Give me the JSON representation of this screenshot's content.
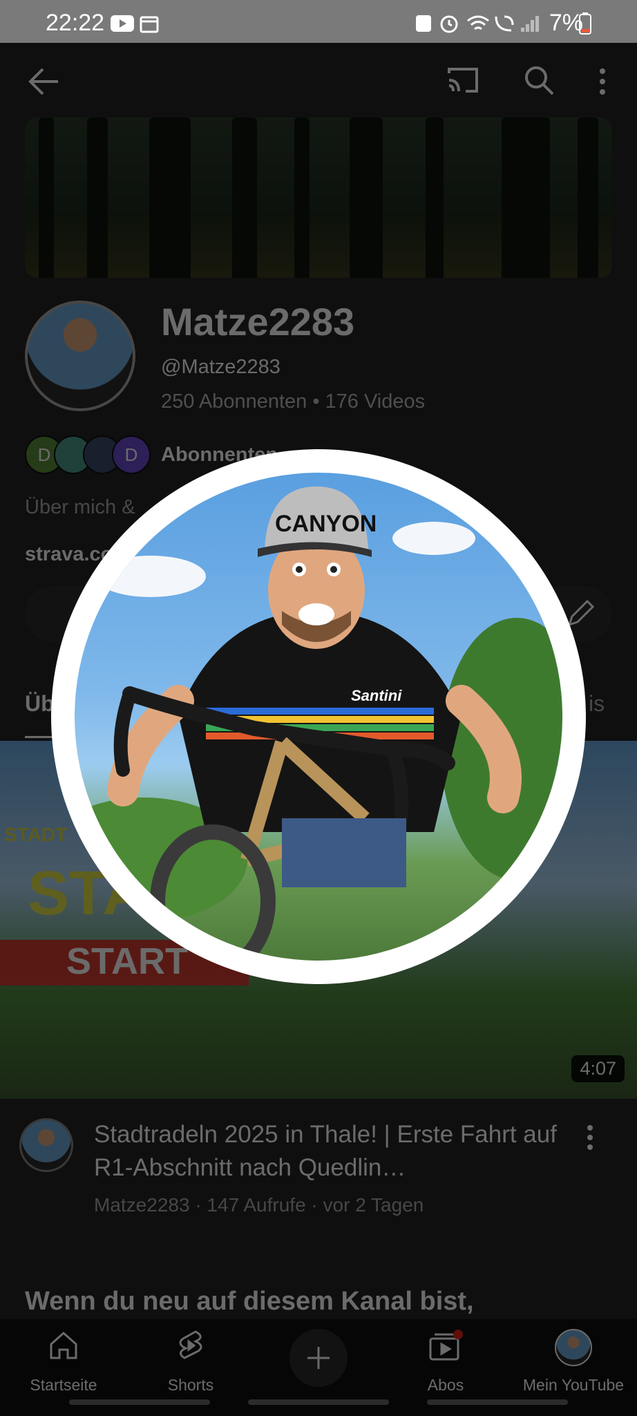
{
  "status_bar": {
    "time": "22:22",
    "battery": "7%"
  },
  "top_bar": {
    "back_icon": "arrow-left-icon",
    "cast_icon": "cast-icon",
    "search_icon": "search-icon",
    "more_icon": "more-vert-icon"
  },
  "channel": {
    "name": "Matze2283",
    "handle": "@Matze2283",
    "meta": "250 Abonnenten • 176 Videos",
    "subscribers_label": "Abonnenten",
    "subscriber_avatars": [
      "D",
      "",
      "",
      "D"
    ],
    "about": "Über mich & ",
    "link": "strava.co"
  },
  "tabs": {
    "left": "Üb",
    "right": "is"
  },
  "thumbnail_text": {
    "stadt": "STADT",
    "sta": "STA",
    "start": "START"
  },
  "video": {
    "duration": "4:07",
    "title": "Stadtradeln 2025 in Thale! | Erste Fahrt auf R1-Abschnitt nach Quedlin…",
    "meta": "Matze2283 · 147 Aufrufe · vor 2 Tagen"
  },
  "section_heading": "Wenn du neu auf diesem Kanal bist,",
  "bottom_nav": {
    "home": "Startseite",
    "shorts": "Shorts",
    "subs": "Abos",
    "you": "Mein YouTube"
  },
  "avatar_preview": {
    "cap_text": "CANYON",
    "shirt_text": "Santini"
  },
  "colors": {
    "background": "#0f0f0f",
    "status_bar": "#7a7a7a",
    "notification_dot": "#e62117",
    "battery_low": "#e85c3a"
  }
}
